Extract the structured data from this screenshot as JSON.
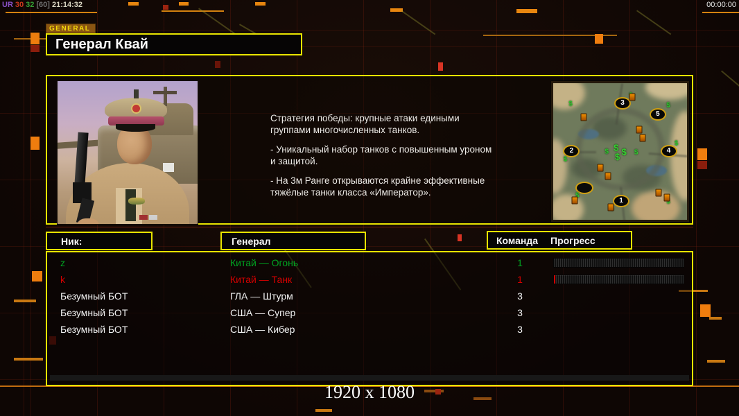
{
  "colors": {
    "accent_yellow": "#e8e400",
    "accent_orange": "#d4820f",
    "player_green": "#00a321",
    "player_red": "#d40000",
    "text_white": "#f2f2f2"
  },
  "top_bar": {
    "debug": {
      "tag": "UR",
      "num1": "30",
      "num2": "32",
      "bracket": "[60]",
      "clock": "21:14:32"
    },
    "match_timer": "00:00:00"
  },
  "header": {
    "tab_label": "GENERAL",
    "title": "Генерал Квай"
  },
  "briefing": {
    "paragraphs": [
      "Стратегия победы: крупные атаки едиными\n группами многочисленных танков.",
      "- Уникальный набор танков с повышенным уроном\n и защитой.",
      "- На 3м Ранге открываются крайне эффективные\n тяжёлые танки класса «Император»."
    ]
  },
  "players_table": {
    "headers": {
      "nick": "Ник:",
      "general": "Генерал",
      "team": "Команда",
      "progress": "Прогресс"
    },
    "rows": [
      {
        "nick": "z",
        "general": "Китай — Огонь",
        "team": "1",
        "color": "#00a321",
        "progress_pct": 0
      },
      {
        "nick": "k",
        "general": "Китай — Танк",
        "team": "1",
        "color": "#d40000",
        "progress_pct": 1
      },
      {
        "nick": "Безумный БОТ",
        "general": "ГЛА — Штурм",
        "team": "3",
        "color": "#f2f2f2",
        "progress_pct": null
      },
      {
        "nick": "Безумный БОТ",
        "general": "США — Супер",
        "team": "3",
        "color": "#f2f2f2",
        "progress_pct": null
      },
      {
        "nick": "Безумный БОТ",
        "general": "США — Кибер",
        "team": "3",
        "color": "#f2f2f2",
        "progress_pct": null
      }
    ]
  },
  "map": {
    "markers": [
      {
        "type": "spot",
        "label": "3",
        "x": 51.8,
        "y": 14.9
      },
      {
        "type": "spot",
        "label": "5",
        "x": 78.2,
        "y": 22.9
      },
      {
        "type": "spot",
        "label": "2",
        "x": 13.7,
        "y": 49.8
      },
      {
        "type": "spot",
        "label": "4",
        "x": 86.3,
        "y": 49.8
      },
      {
        "type": "spot",
        "label": "1",
        "x": 50.8,
        "y": 86.1
      },
      {
        "type": "start",
        "label": "",
        "x": 23.4,
        "y": 76.6
      },
      {
        "type": "money",
        "label": "$",
        "x": 13,
        "y": 15
      },
      {
        "type": "money",
        "label": "$",
        "x": 58,
        "y": 9
      },
      {
        "type": "money",
        "label": "$",
        "x": 86,
        "y": 16
      },
      {
        "type": "money",
        "label": "$",
        "x": 92,
        "y": 44
      },
      {
        "type": "money",
        "label": "$",
        "x": 40,
        "y": 50
      },
      {
        "type": "money",
        "label": "$",
        "x": 62,
        "y": 51
      },
      {
        "type": "money",
        "label": "$",
        "x": 9,
        "y": 56
      },
      {
        "type": "money",
        "label": "$",
        "x": 86,
        "y": 87
      },
      {
        "type": "money",
        "label": "$",
        "x": 18,
        "y": 82
      },
      {
        "type": "money",
        "label": "$",
        "x": 44,
        "y": 92
      },
      {
        "type": "oil",
        "label": "",
        "x": 23,
        "y": 25
      },
      {
        "type": "oil",
        "label": "",
        "x": 59,
        "y": 10
      },
      {
        "type": "oil",
        "label": "",
        "x": 64,
        "y": 34
      },
      {
        "type": "oil",
        "label": "",
        "x": 67,
        "y": 40
      },
      {
        "type": "oil",
        "label": "",
        "x": 35,
        "y": 62
      },
      {
        "type": "oil",
        "label": "",
        "x": 41,
        "y": 68
      },
      {
        "type": "oil",
        "label": "",
        "x": 79,
        "y": 80
      },
      {
        "type": "oil",
        "label": "",
        "x": 85,
        "y": 84
      },
      {
        "type": "oil",
        "label": "",
        "x": 16,
        "y": 86
      },
      {
        "type": "oil",
        "label": "",
        "x": 43,
        "y": 91
      },
      {
        "type": "center",
        "label": "$",
        "x": 47,
        "y": 47
      },
      {
        "type": "center",
        "label": "$",
        "x": 53,
        "y": 50
      },
      {
        "type": "center",
        "label": "$",
        "x": 48,
        "y": 54
      }
    ]
  },
  "footer": {
    "resolution": "1920 x 1080"
  }
}
